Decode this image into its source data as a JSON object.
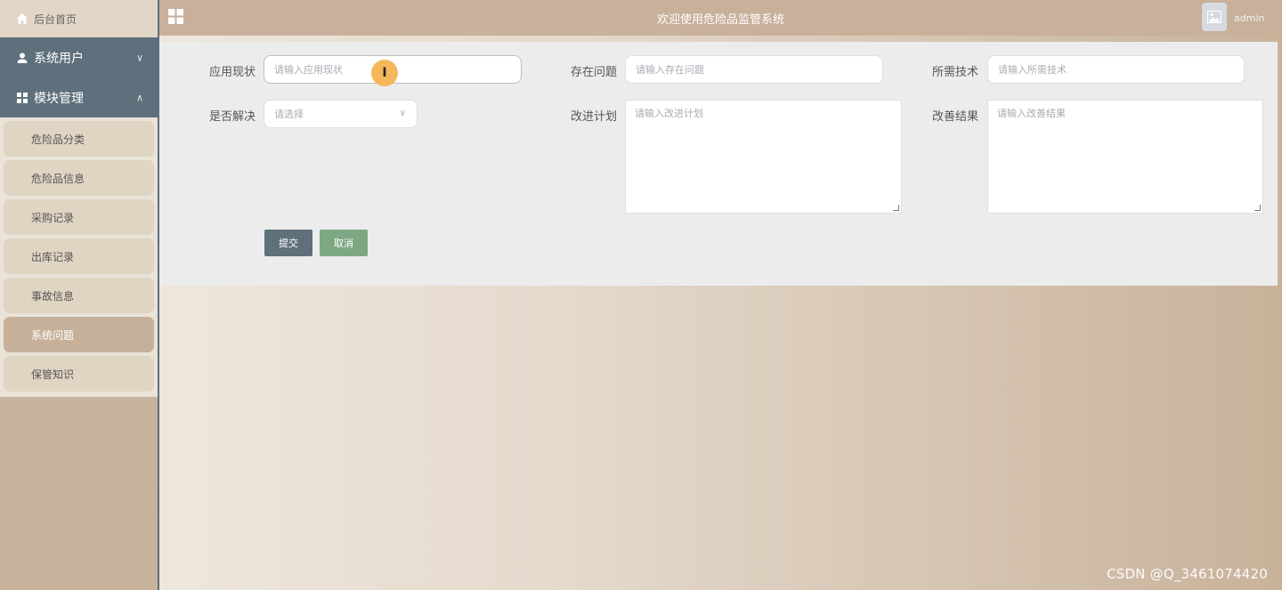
{
  "sidebar": {
    "home_label": "后台首页",
    "groups": [
      {
        "label": "系统用户",
        "chevron": "chevron-down-icon"
      },
      {
        "label": "模块管理",
        "chevron": "chevron-up-icon"
      }
    ],
    "items": [
      {
        "label": "危险品分类"
      },
      {
        "label": "危险品信息"
      },
      {
        "label": "采购记录"
      },
      {
        "label": "出库记录"
      },
      {
        "label": "事故信息"
      },
      {
        "label": "系统问题"
      },
      {
        "label": "保管知识"
      }
    ],
    "active_item": "系统问题"
  },
  "header": {
    "title": "欢迎使用危险品监管系统",
    "username": "admin"
  },
  "form": {
    "fields": {
      "current_status": {
        "label": "应用现状",
        "placeholder": "请输入应用现状"
      },
      "existing_problem": {
        "label": "存在问题",
        "placeholder": "请输入存在问题"
      },
      "required_tech": {
        "label": "所需技术",
        "placeholder": "请输入所需技术"
      },
      "resolved": {
        "label": "是否解决",
        "placeholder": "请选择"
      },
      "improvement_plan": {
        "label": "改进计划",
        "placeholder": "请输入改进计划"
      },
      "improvement_result": {
        "label": "改善结果",
        "placeholder": "请输入改善结果"
      }
    },
    "buttons": {
      "submit": "提交",
      "cancel": "取消"
    }
  },
  "cursor_symbol": "I",
  "watermark": "CSDN @Q_3461074420",
  "colors": {
    "topbar": "#c8b09a",
    "sidebar_group": "#5e707c",
    "active_item": "#c6b099",
    "submit_button": "#5f707b",
    "cancel_button": "#7ea883"
  }
}
